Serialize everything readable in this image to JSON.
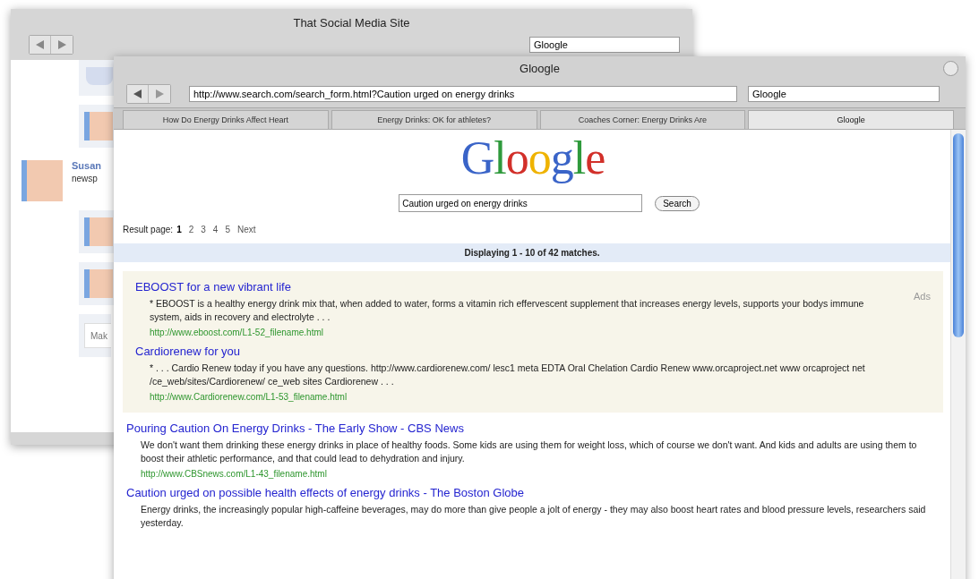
{
  "back_window": {
    "title": "That Social Media Site",
    "search": {
      "value": "Gloogle"
    },
    "posts": [
      {
        "kind": "faded"
      },
      {
        "kind": "avatar"
      },
      {
        "kind": "author",
        "name": "Susan",
        "text": "newsp"
      },
      {
        "kind": "avatar"
      },
      {
        "kind": "avatar"
      },
      {
        "kind": "composer",
        "placeholder": "Mak"
      }
    ]
  },
  "front_window": {
    "title": "Gloogle",
    "address": {
      "value": "http://www.search.com/search_form.html?Caution urged on energy drinks"
    },
    "search": {
      "value": "Gloogle"
    },
    "tabs": [
      {
        "label": "How Do Energy Drinks Affect Heart",
        "selected": false
      },
      {
        "label": "Energy Drinks: OK for athletes?",
        "selected": false
      },
      {
        "label": "Coaches Corner: Energy Drinks Are",
        "selected": false
      },
      {
        "label": "Gloogle",
        "selected": true
      }
    ],
    "logo": [
      {
        "char": "G",
        "color": "#3a64c8"
      },
      {
        "char": "l",
        "color": "#2f9a3c"
      },
      {
        "char": "o",
        "color": "#d2302a"
      },
      {
        "char": "o",
        "color": "#efb300"
      },
      {
        "char": "g",
        "color": "#3a64c8"
      },
      {
        "char": "l",
        "color": "#2f9a3c"
      },
      {
        "char": "e",
        "color": "#d2302a"
      }
    ],
    "query": {
      "value": "Caution urged on energy drinks"
    },
    "search_button": "Search",
    "result_page": {
      "label": "Result page:",
      "pages": [
        {
          "label": "1",
          "selected": true
        },
        {
          "label": "2",
          "selected": false
        },
        {
          "label": "3",
          "selected": false
        },
        {
          "label": "4",
          "selected": false
        },
        {
          "label": "5",
          "selected": false
        }
      ],
      "next": "Next"
    },
    "summary": "Displaying 1 - 10 of 42 matches.",
    "ads": {
      "label": "Ads",
      "items": [
        {
          "title": "EBOOST for a new vibrant life",
          "snippet": "* EBOOST is a healthy energy drink mix that, when added to water, forms a vitamin rich effervescent supplement that increases energy levels, supports your bodys immune system, aids in recovery and electrolyte . . .",
          "url": "http://www.eboost.com/L1-52_filename.html"
        },
        {
          "title": "Cardiorenew for you",
          "snippet": "* . . . Cardio Renew today if you have any questions. http://www.cardiorenew.com/ lesc1 meta EDTA Oral Chelation Cardio Renew www.orcaproject.net www orcaproject net /ce_web/sites/Cardiorenew/ ce_web sites Cardiorenew . . .",
          "url": "http://www.Cardiorenew.com/L1-53_filename.html"
        }
      ]
    },
    "results": [
      {
        "title": "Pouring Caution On Energy Drinks - The Early Show - CBS News",
        "snippet": "We don't want them drinking these energy drinks in place of healthy foods. Some kids are using them for weight loss, which of course we don't want. And kids and adults are using them to boost their athletic performance, and that could lead to dehydration and injury.",
        "url": "http://www.CBSnews.com/L1-43_filename.html"
      },
      {
        "title": "Caution urged on possible health effects of energy drinks - The Boston Globe",
        "snippet": "Energy drinks, the increasingly popular high-caffeine beverages, may do more than give people a jolt of energy - they may also boost heart rates and blood pressure levels, researchers said yesterday."
      }
    ]
  }
}
